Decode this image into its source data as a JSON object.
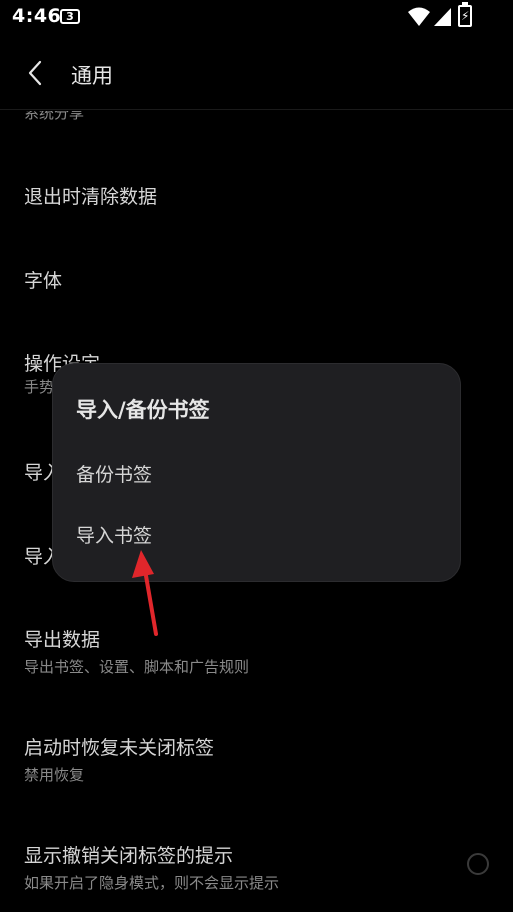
{
  "status_bar": {
    "time": "4:46",
    "notification_badge": "3"
  },
  "header": {
    "title": "通用"
  },
  "list": {
    "items": [
      {
        "title": "系统分享",
        "subtitle": ""
      },
      {
        "title": "退出时清除数据",
        "subtitle": ""
      },
      {
        "title": "字体",
        "subtitle": ""
      },
      {
        "title": "操作设定",
        "subtitle": "手势"
      },
      {
        "title": "导入",
        "subtitle": ""
      },
      {
        "title": "导入",
        "subtitle": ""
      },
      {
        "title": "导出数据",
        "subtitle": "导出书签、设置、脚本和广告规则"
      },
      {
        "title": "启动时恢复未关闭标签",
        "subtitle": "禁用恢复"
      },
      {
        "title": "显示撤销关闭标签的提示",
        "subtitle": "如果开启了隐身模式，则不会显示提示"
      }
    ]
  },
  "dialog": {
    "title": "导入/备份书签",
    "options": [
      {
        "label": "备份书签"
      },
      {
        "label": "导入书签"
      }
    ]
  },
  "colors": {
    "background": "#000000",
    "dialog_bg": "#1f1f22",
    "annotation_arrow": "#e0262b"
  }
}
